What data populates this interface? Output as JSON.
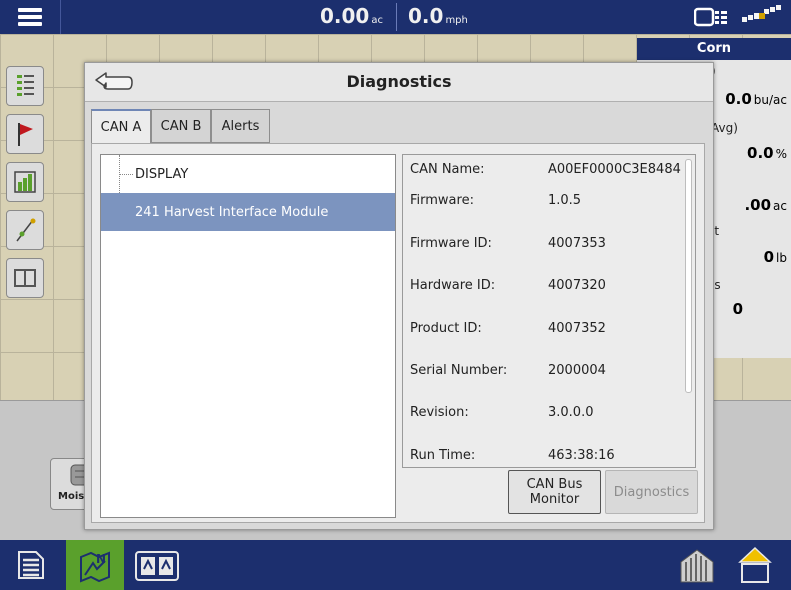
{
  "topbar": {
    "area": {
      "value": "0.00",
      "unit": "ac"
    },
    "speed": {
      "value": "0.0",
      "unit": "mph"
    }
  },
  "right_panel": {
    "crop": "Corn",
    "rows": [
      {
        "label": ")",
        "value": "0.0",
        "unit": "bu/ac"
      },
      {
        "label": "Avg)",
        "value": "0.0",
        "unit": "%"
      },
      {
        "label": "",
        "value": ".00",
        "unit": "ac"
      },
      {
        "label": "it",
        "value": "0",
        "unit": "lb"
      },
      {
        "label": "ls",
        "value": "0",
        "unit": ""
      }
    ]
  },
  "moisture_button": {
    "label": "Mois"
  },
  "dialog": {
    "title": "Diagnostics",
    "tabs": [
      {
        "label": "CAN A",
        "active": true
      },
      {
        "label": "CAN B",
        "active": false
      },
      {
        "label": "Alerts",
        "active": false
      }
    ],
    "tree": [
      {
        "label": "DISPLAY",
        "selected": false
      },
      {
        "label": "241 Harvest Interface Module",
        "selected": true
      }
    ],
    "properties": [
      {
        "key": "CAN Name:",
        "value": "A00EF0000C3E8484"
      },
      {
        "key": "Firmware:",
        "value": "1.0.5"
      },
      {
        "key": "Firmware ID:",
        "value": "4007353"
      },
      {
        "key": "Hardware ID:",
        "value": "4007320"
      },
      {
        "key": "Product ID:",
        "value": "4007352"
      },
      {
        "key": "Serial Number:",
        "value": "2000004"
      },
      {
        "key": "Revision:",
        "value": "3.0.0.0"
      },
      {
        "key": "Run Time:",
        "value": "463:38:16"
      }
    ],
    "buttons": {
      "can_bus_monitor": "CAN Bus\nMonitor",
      "diagnostics": "Diagnostics"
    }
  },
  "colors": {
    "navy": "#1c2f6e",
    "selection": "#7c94bf",
    "map_green": "#5aa02c"
  }
}
